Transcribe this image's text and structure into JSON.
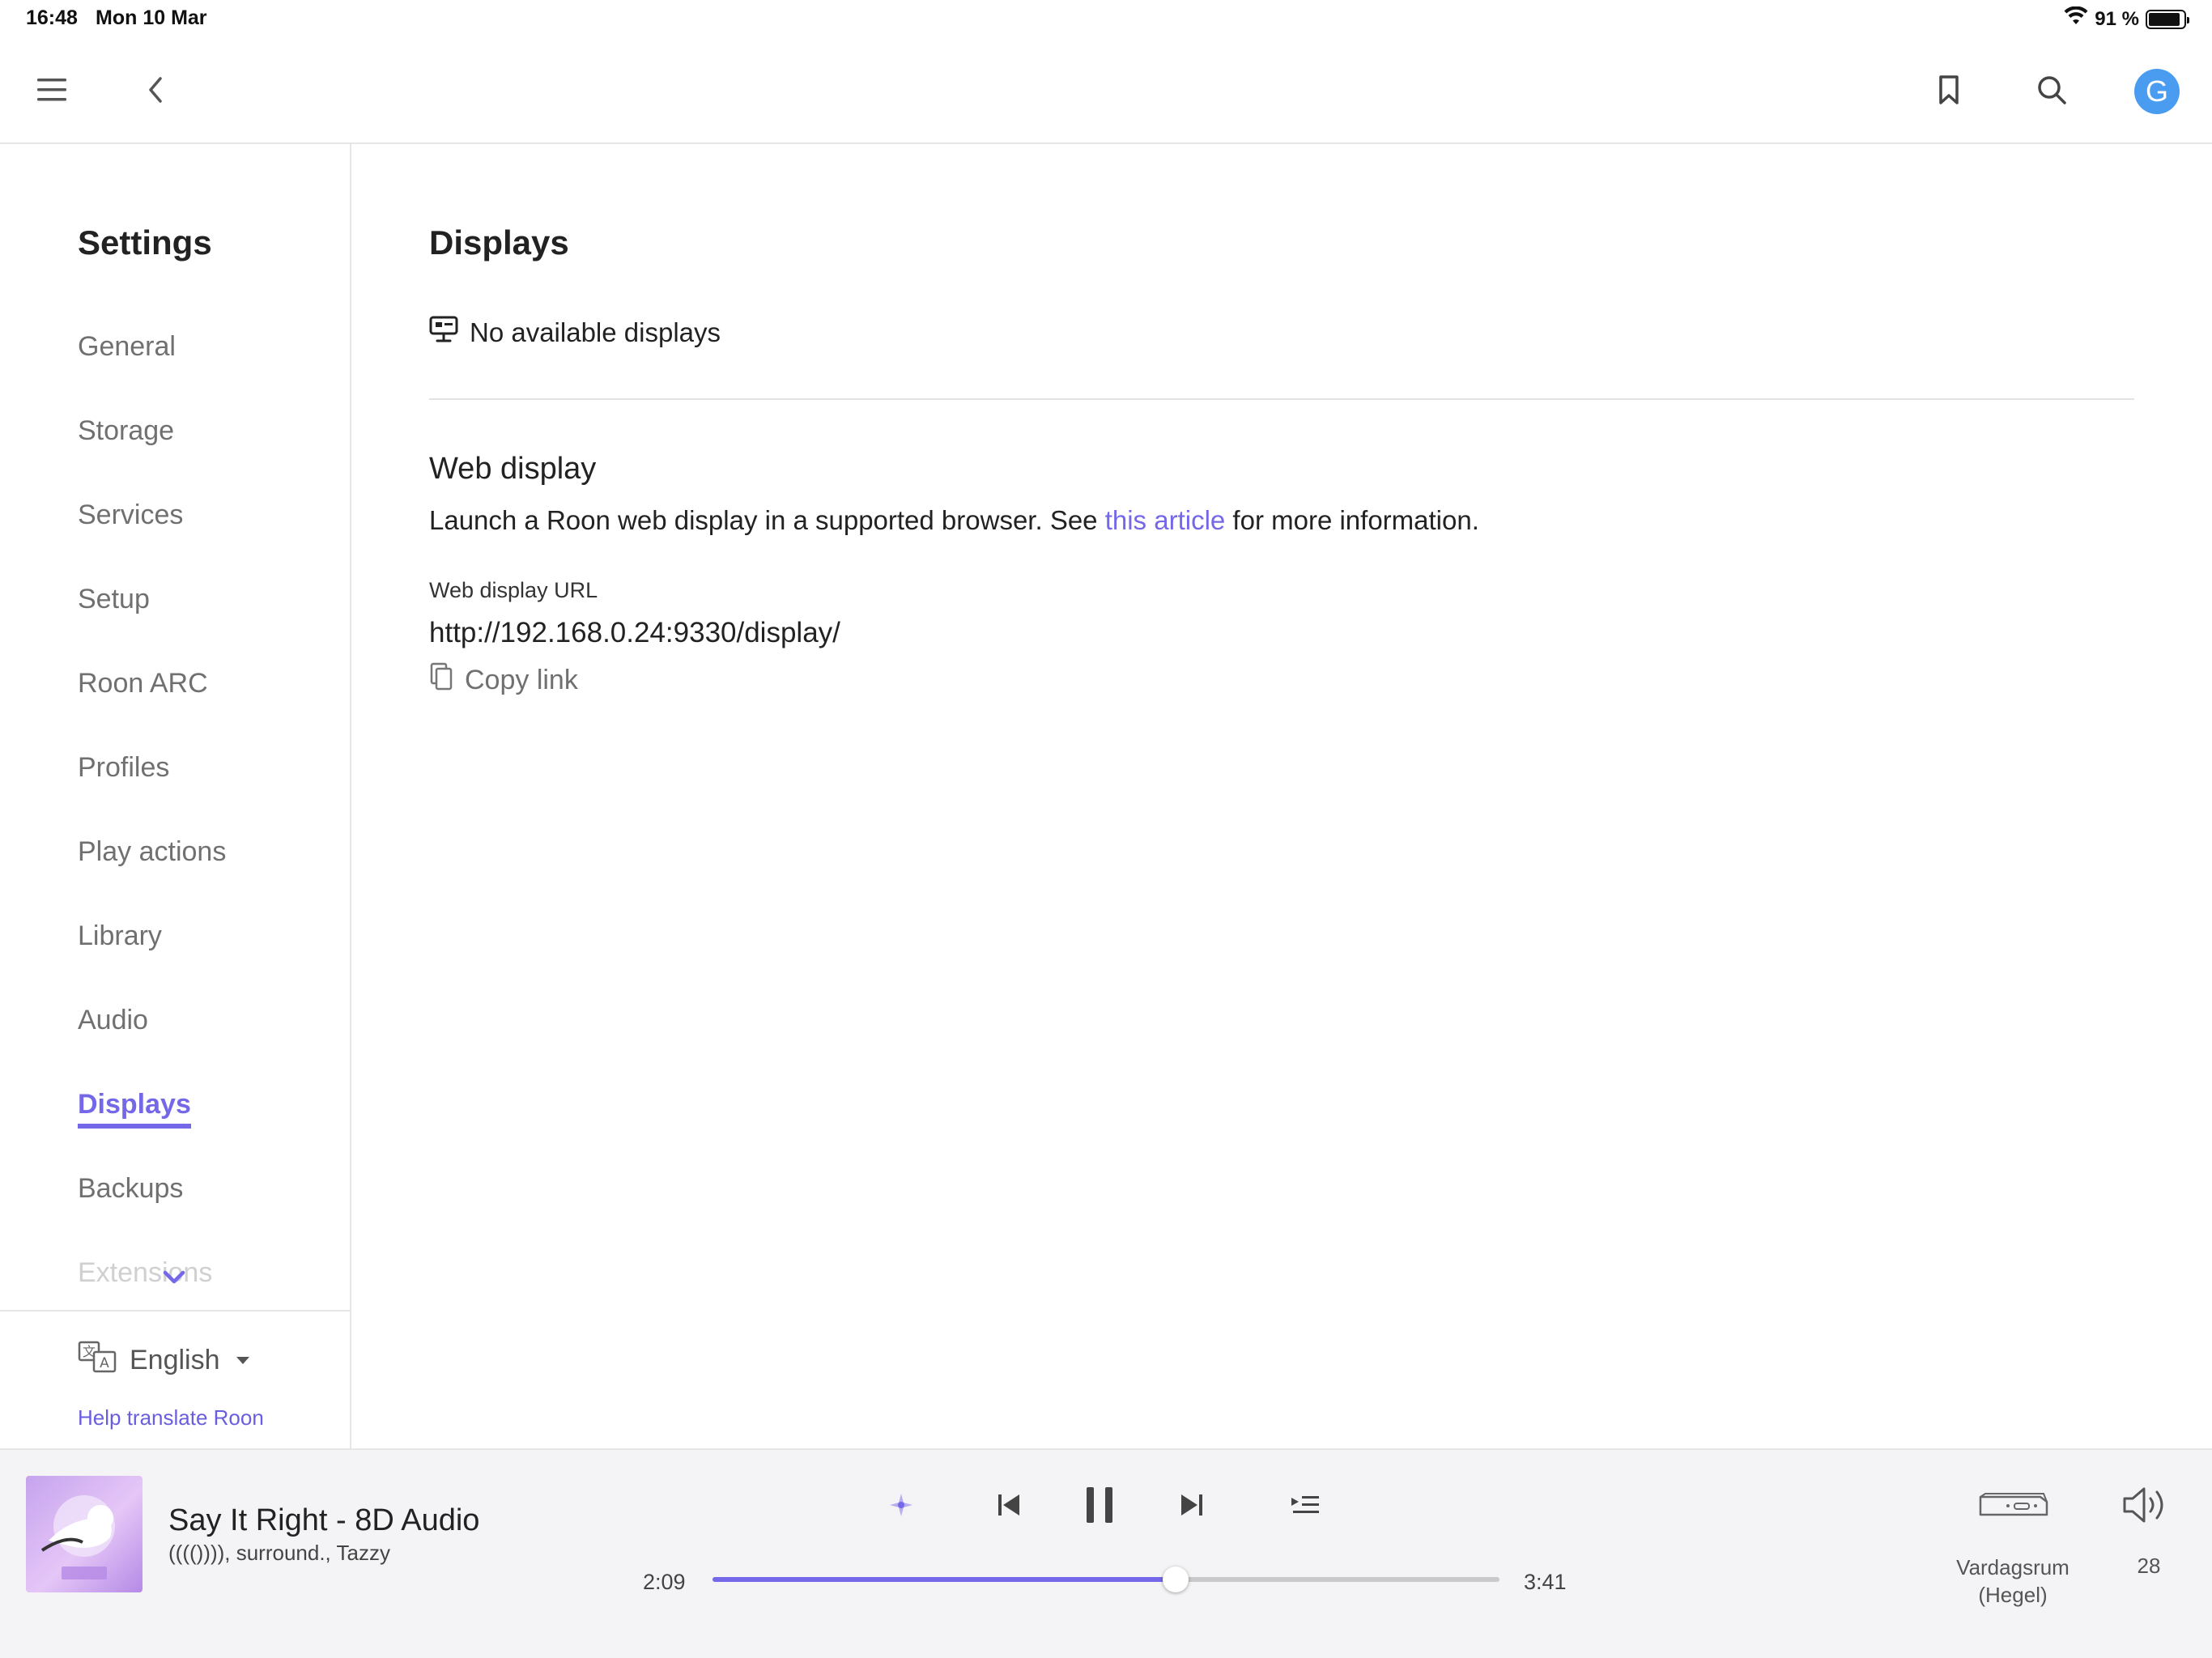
{
  "status_bar": {
    "time": "16:48",
    "date": "Mon 10 Mar",
    "battery": "91 %",
    "battery_level": 0.91
  },
  "top_nav": {
    "avatar_initial": "G"
  },
  "sidebar": {
    "title": "Settings",
    "items": [
      {
        "label": "General"
      },
      {
        "label": "Storage"
      },
      {
        "label": "Services"
      },
      {
        "label": "Setup"
      },
      {
        "label": "Roon ARC"
      },
      {
        "label": "Profiles"
      },
      {
        "label": "Play actions"
      },
      {
        "label": "Library"
      },
      {
        "label": "Audio"
      },
      {
        "label": "Displays",
        "active": true
      },
      {
        "label": "Backups"
      },
      {
        "label": "Extensions"
      }
    ],
    "language": "English",
    "help_link": "Help translate Roon"
  },
  "main": {
    "title": "Displays",
    "no_displays": "No available displays",
    "web_display": {
      "title": "Web display",
      "description_before": "Launch a Roon web display in a supported browser. See ",
      "description_link": "this article",
      "description_after": " for more information.",
      "url_label": "Web display URL",
      "url": "http://192.168.0.24:9330/display/",
      "copy_label": "Copy link"
    }
  },
  "player": {
    "track_title": "Say It Right - 8D Audio",
    "artists": "(((()))), surround., Tazzy",
    "time_elapsed": "2:09",
    "time_total": "3:41",
    "progress": 0.588,
    "zone_name_line1": "Vardagsrum",
    "zone_name_line2": "(Hegel)",
    "volume": "28"
  },
  "colors": {
    "accent": "#7468e8",
    "avatar": "#4a9cf0"
  }
}
